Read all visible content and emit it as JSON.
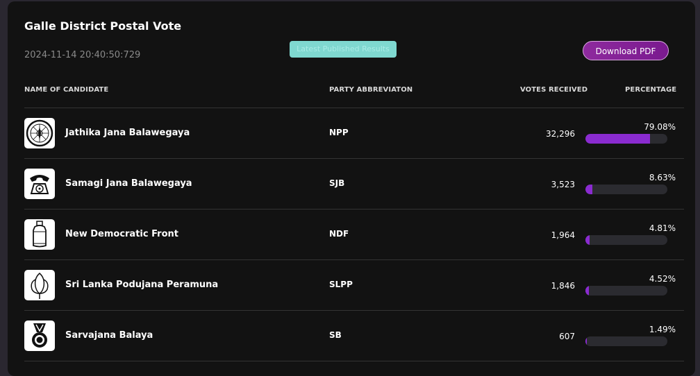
{
  "header": {
    "title": "Galle District Postal Vote",
    "timestamp": "2024-11-14 20:40:50:729",
    "badge": "Latest Published Results",
    "download_label": "Download PDF"
  },
  "columns": {
    "candidate": "NAME OF CANDIDATE",
    "party": "PARTY ABBREVIATON",
    "votes": "VOTES RECEIVED",
    "percentage": "PERCENTAGE"
  },
  "colors": {
    "accent": "#8a2bd0",
    "badge": "#7fd8d0",
    "button": "#8e2a9e"
  },
  "rows": [
    {
      "name": "Jathika Jana Balawegaya",
      "party": "NPP",
      "votes": "32,296",
      "percentage": "79.08%",
      "fraction": 0.7908,
      "symbol": "compass-symbol-icon"
    },
    {
      "name": "Samagi Jana Balawegaya",
      "party": "SJB",
      "votes": "3,523",
      "percentage": "8.63%",
      "fraction": 0.0863,
      "symbol": "telephone-symbol-icon"
    },
    {
      "name": "New Democratic Front",
      "party": "NDF",
      "votes": "1,964",
      "percentage": "4.81%",
      "fraction": 0.0481,
      "symbol": "gas-cylinder-symbol-icon"
    },
    {
      "name": "Sri Lanka Podujana Peramuna",
      "party": "SLPP",
      "votes": "1,846",
      "percentage": "4.52%",
      "fraction": 0.0452,
      "symbol": "lotus-bud-symbol-icon"
    },
    {
      "name": "Sarvajana Balaya",
      "party": "SB",
      "votes": "607",
      "percentage": "1.49%",
      "fraction": 0.0149,
      "symbol": "medal-symbol-icon"
    }
  ]
}
